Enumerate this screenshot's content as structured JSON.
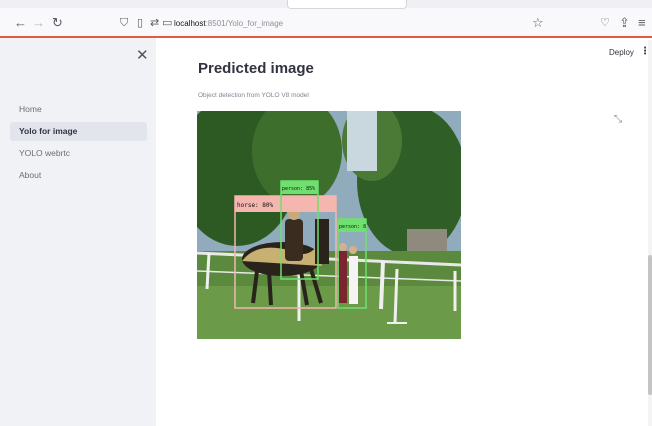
{
  "browser": {
    "url_host": "localhost",
    "url_rest": ":8501/Yolo_for_image"
  },
  "sidebar": {
    "items": [
      {
        "label": "Home"
      },
      {
        "label": "Yolo for image"
      },
      {
        "label": "YOLO webrtc"
      },
      {
        "label": "About"
      }
    ]
  },
  "header": {
    "deploy_label": "Deploy"
  },
  "main": {
    "title": "Predicted image",
    "caption": "Object detection from YOLO V8 model"
  },
  "detections": [
    {
      "label": "horse: 80%"
    },
    {
      "label": "person: 85%"
    },
    {
      "label": "person: 8"
    }
  ],
  "colors": {
    "accent": "#e25a3f",
    "horse_box": "#f4b6ae",
    "person_box": "#6fe06f"
  }
}
